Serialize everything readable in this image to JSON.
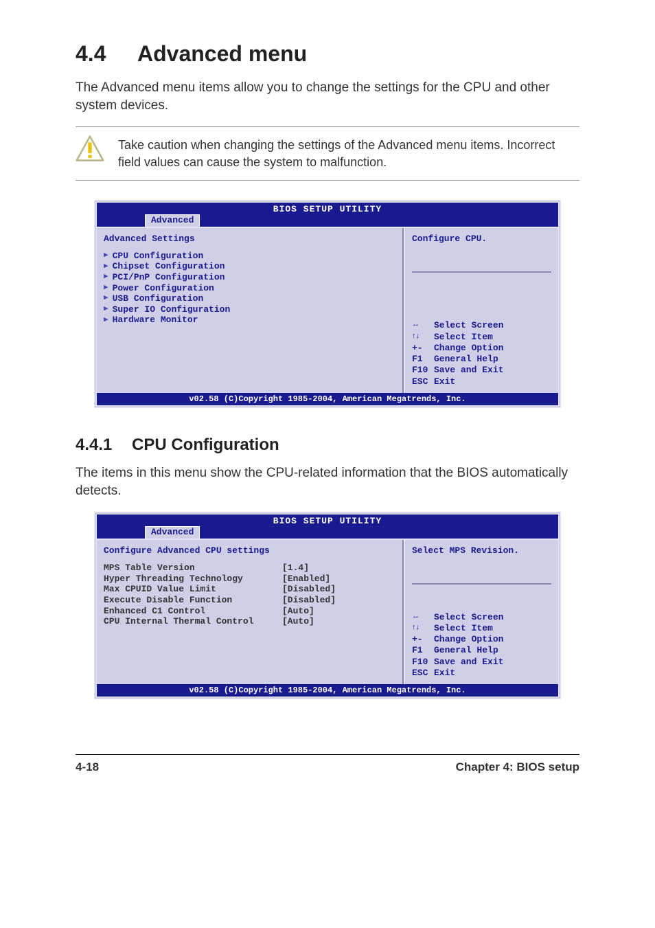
{
  "section": {
    "number": "4.4",
    "title": "Advanced menu",
    "intro": "The Advanced menu items allow you to change the settings for the CPU and other system devices."
  },
  "caution": {
    "text": "Take caution when changing the settings of the Advanced menu items. Incorrect field values can cause the system to malfunction."
  },
  "bios1": {
    "header_title": "BIOS SETUP UTILITY",
    "tab": "Advanced",
    "panel_heading": "Advanced Settings",
    "menu_items": [
      "CPU Configuration",
      "Chipset Configuration",
      "PCI/PnP Configuration",
      "Power Configuration",
      "USB Configuration",
      "Super IO Configuration",
      "Hardware Monitor"
    ],
    "help_top": "Configure CPU.",
    "keys": [
      {
        "k": "↔",
        "icon": true,
        "t": "Select Screen"
      },
      {
        "k": "↑↓",
        "icon": true,
        "t": "Select Item"
      },
      {
        "k": "+-",
        "t": "Change Option"
      },
      {
        "k": "F1",
        "t": "General Help"
      },
      {
        "k": "F10",
        "t": "Save and Exit"
      },
      {
        "k": "ESC",
        "t": "Exit"
      }
    ],
    "footer": "v02.58 (C)Copyright 1985-2004, American Megatrends, Inc."
  },
  "subsection": {
    "number": "4.4.1",
    "title": "CPU Configuration",
    "intro": "The items in this menu show the CPU-related information that the BIOS automatically detects."
  },
  "bios2": {
    "header_title": "BIOS SETUP UTILITY",
    "tab": "Advanced",
    "panel_heading": "Configure Advanced CPU settings",
    "settings": [
      {
        "label": "MPS Table Version",
        "value": "[1.4]"
      },
      {
        "label": "Hyper Threading Technology",
        "value": "[Enabled]"
      },
      {
        "label": "Max CPUID Value Limit",
        "value": "[Disabled]"
      },
      {
        "label": "Execute Disable Function",
        "value": "[Disabled]"
      },
      {
        "label": "Enhanced C1 Control",
        "value": "[Auto]"
      },
      {
        "label": "CPU Internal Thermal Control",
        "value": "[Auto]"
      }
    ],
    "help_top": "Select MPS Revision.",
    "keys": [
      {
        "k": "↔",
        "icon": true,
        "t": "Select Screen"
      },
      {
        "k": "↑↓",
        "icon": true,
        "t": "Select Item"
      },
      {
        "k": "+-",
        "t": "Change Option"
      },
      {
        "k": "F1",
        "t": "General Help"
      },
      {
        "k": "F10",
        "t": "Save and Exit"
      },
      {
        "k": "ESC",
        "t": "Exit"
      }
    ],
    "footer": "v02.58 (C)Copyright 1985-2004, American Megatrends, Inc."
  },
  "page_footer": {
    "left": "4-18",
    "right": "Chapter 4: BIOS setup"
  }
}
